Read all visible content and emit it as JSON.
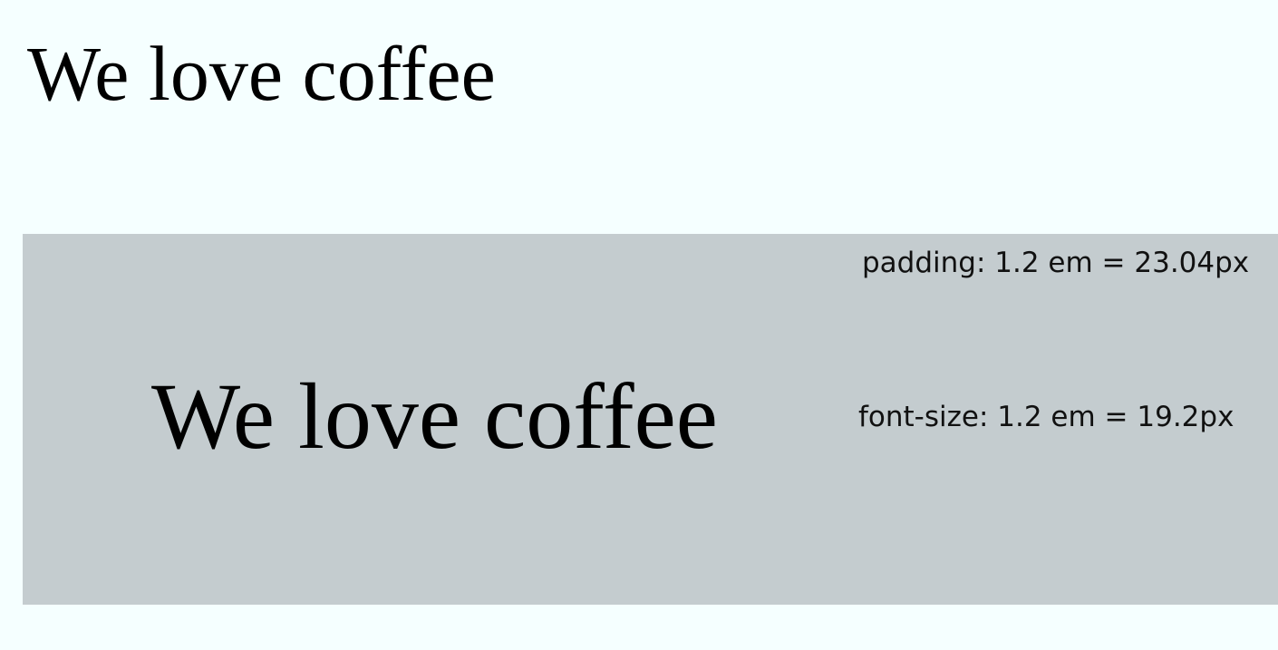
{
  "page": {
    "background": "#f5ffff"
  },
  "top_heading": {
    "text": "We love coffee"
  },
  "demo_box": {
    "background": "#c4cccf",
    "heading": "We love coffee",
    "padding_note": "padding: 1.2 em = 23.04px",
    "font_size_note": "font-size: 1.2 em = 19.2px"
  }
}
